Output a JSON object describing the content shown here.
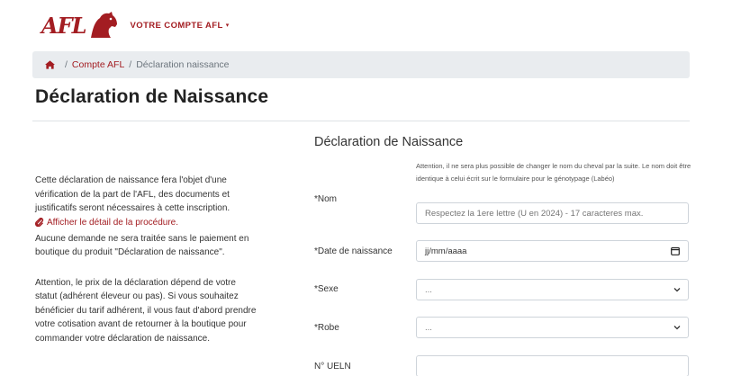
{
  "header": {
    "logo_text": "AFL",
    "account_menu_label": "VOTRE COMPTE AFL",
    "account_menu_caret": "▾"
  },
  "breadcrumb": {
    "items": [
      "Compte AFL",
      "Déclaration naissance"
    ],
    "separator": "/"
  },
  "page_title": "Déclaration de Naissance",
  "left": {
    "para1_text": "Cette déclaration de naissance fera l'objet d'une vérification de la part de l'AFL, des documents et justificatifs seront nécessaires à cette inscription.",
    "procedure_link": "Afficher le détail de la procédure.",
    "para1_tail": "Aucune demande ne sera traitée sans le paiement en boutique du produit \"Déclaration de naissance\".",
    "para2": "Attention, le prix de la déclaration dépend de votre statut (adhérent éleveur ou pas). Si vous souhaitez bénéficier du tarif adhérent, il vous faut d'abord prendre votre cotisation avant de retourner à la boutique pour commander votre déclaration de naissance."
  },
  "form": {
    "title": "Déclaration de Naissance",
    "help_text": "Attention, il ne sera plus possible de changer le nom du cheval par la suite. Le nom doit être identique à celui écrit sur le formulaire pour le génotypage (Labéo)",
    "fields": [
      {
        "label": "*Nom",
        "placeholder": "Respectez la 1ere lettre (U en 2024) - 17 caracteres max."
      },
      {
        "label": "*Date de naissance",
        "value": "jj/mm/aaaa"
      },
      {
        "label": "*Sexe",
        "value": "..."
      },
      {
        "label": "*Robe",
        "value": "..."
      },
      {
        "label": "N° UELN",
        "value": ""
      }
    ]
  },
  "colors": {
    "brand": "#a31d22",
    "breadcrumb_bg": "#e9ecef"
  },
  "icons": [
    "horse-head-logo",
    "home-icon",
    "paperclip-icon",
    "calendar-icon",
    "chevron-down-icon"
  ]
}
